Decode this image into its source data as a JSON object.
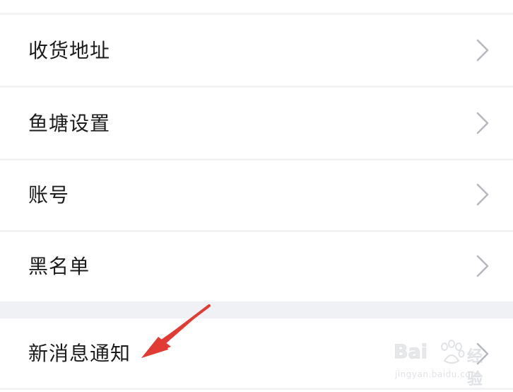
{
  "settings_list": {
    "items": [
      {
        "label": "收货地址"
      },
      {
        "label": "鱼塘设置"
      },
      {
        "label": "账号"
      },
      {
        "label": "黑名单"
      },
      {
        "label": "新消息通知"
      }
    ]
  },
  "watermark": {
    "logo": "Bai",
    "logo_suffix": "经验",
    "url": "jingyan.baidu.com"
  },
  "colors": {
    "text": "#1c1c1c",
    "chevron": "#b5b8bd",
    "divider": "#f1f2f4",
    "section_gap": "#eff1f4",
    "arrow": "#e23b34"
  },
  "icons": {
    "row_chevron": "chevron-right-icon",
    "annotation": "red-arrow-annotation"
  }
}
